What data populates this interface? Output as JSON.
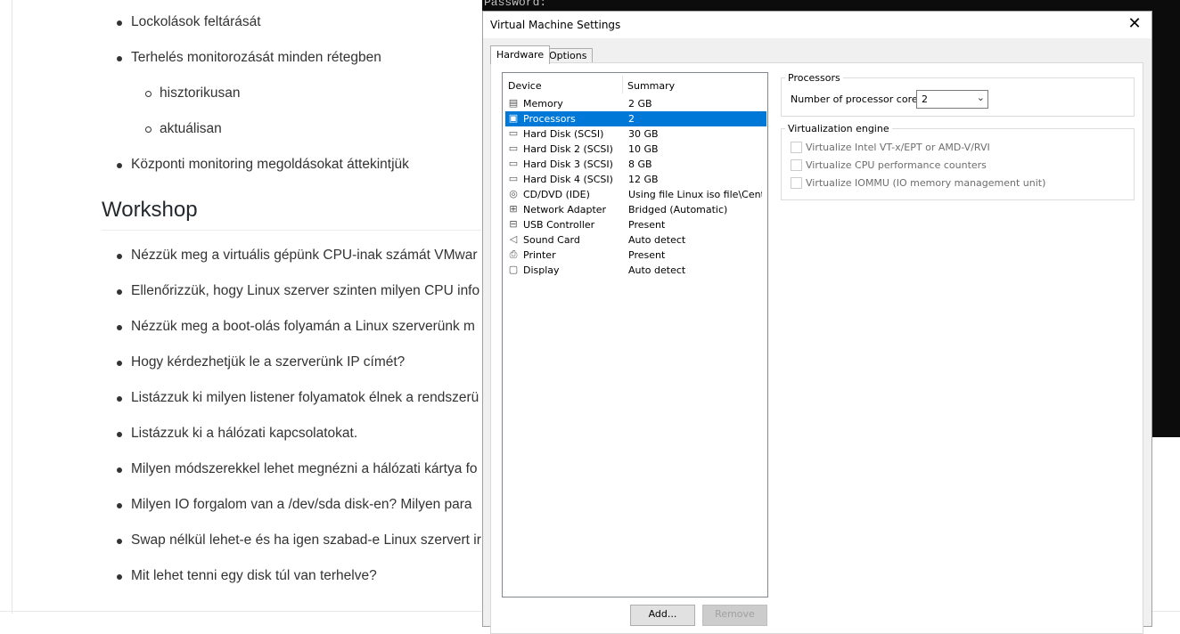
{
  "document": {
    "bullets_top": [
      {
        "text": "Lockolások feltárását",
        "level": 1
      },
      {
        "text": "Terhelés monitorozását minden rétegben",
        "level": 1
      },
      {
        "text": "hisztorikusan",
        "level": 2
      },
      {
        "text": "aktuálisan",
        "level": 2
      },
      {
        "text": "Központi monitoring megoldásokat áttekintjük",
        "level": 1
      }
    ],
    "workshop_heading": "Workshop",
    "workshop_items": [
      "Nézzük meg a virtuális gépünk CPU-inak számát VMwar",
      "Ellenőrizzük, hogy Linux szerver szinten milyen CPU info",
      "Nézzük meg a boot-olás folyamán a Linux szerverünk m",
      "Hogy kérdezhetjük le a szerverünk IP címét?",
      "Listázzuk ki milyen listener folyamatok élnek a rendszerü",
      "Listázzuk ki a hálózati kapcsolatokat.",
      "Milyen módszerekkel lehet megnézni a hálózati kártya fo",
      "Milyen IO forgalom van a /dev/sda disk-en? Milyen para",
      "Swap nélkül lehet-e és ha igen szabad-e Linux szervert ir",
      "Mit lehet tenni egy disk túl van terhelve?"
    ]
  },
  "terminal": {
    "text": "Password:"
  },
  "dialog": {
    "title": "Virtual Machine Settings",
    "close_glyph": "✕",
    "tabs": [
      {
        "label": "Hardware",
        "active": true
      },
      {
        "label": "Options",
        "active": false
      }
    ],
    "device_list": {
      "headers": {
        "device": "Device",
        "summary": "Summary"
      },
      "rows": [
        {
          "device": "Memory",
          "summary": "2 GB",
          "icon": "memory-icon",
          "glyph": "▤",
          "selected": false
        },
        {
          "device": "Processors",
          "summary": "2",
          "icon": "processor-icon",
          "glyph": "▣",
          "selected": true
        },
        {
          "device": "Hard Disk (SCSI)",
          "summary": "30 GB",
          "icon": "hard-disk-icon",
          "glyph": "▭",
          "selected": false
        },
        {
          "device": "Hard Disk 2 (SCSI)",
          "summary": "10 GB",
          "icon": "hard-disk-icon",
          "glyph": "▭",
          "selected": false
        },
        {
          "device": "Hard Disk 3 (SCSI)",
          "summary": "8 GB",
          "icon": "hard-disk-icon",
          "glyph": "▭",
          "selected": false
        },
        {
          "device": "Hard Disk 4 (SCSI)",
          "summary": "12 GB",
          "icon": "hard-disk-icon",
          "glyph": "▭",
          "selected": false
        },
        {
          "device": "CD/DVD (IDE)",
          "summary": "Using file Linux iso file\\Cent…",
          "icon": "cd-dvd-icon",
          "glyph": "◎",
          "selected": false
        },
        {
          "device": "Network Adapter",
          "summary": "Bridged (Automatic)",
          "icon": "network-adapter-icon",
          "glyph": "⊞",
          "selected": false
        },
        {
          "device": "USB Controller",
          "summary": "Present",
          "icon": "usb-icon",
          "glyph": "⊟",
          "selected": false
        },
        {
          "device": "Sound Card",
          "summary": "Auto detect",
          "icon": "sound-card-icon",
          "glyph": "◁",
          "selected": false
        },
        {
          "device": "Printer",
          "summary": "Present",
          "icon": "printer-icon",
          "glyph": "⎙",
          "selected": false
        },
        {
          "device": "Display",
          "summary": "Auto detect",
          "icon": "display-icon",
          "glyph": "▢",
          "selected": false
        }
      ]
    },
    "buttons": {
      "add": "Add...",
      "remove": "Remove"
    },
    "processors": {
      "group_label": "Processors",
      "cores_label": "Number of processor cores:",
      "cores_value": "2"
    },
    "virtualization": {
      "group_label": "Virtualization engine",
      "options": [
        {
          "label": "Virtualize Intel VT-x/EPT or AMD-V/RVI",
          "checked": false
        },
        {
          "label": "Virtualize CPU performance counters",
          "checked": false
        },
        {
          "label": "Virtualize IOMMU (IO memory management unit)",
          "checked": false
        }
      ]
    }
  }
}
